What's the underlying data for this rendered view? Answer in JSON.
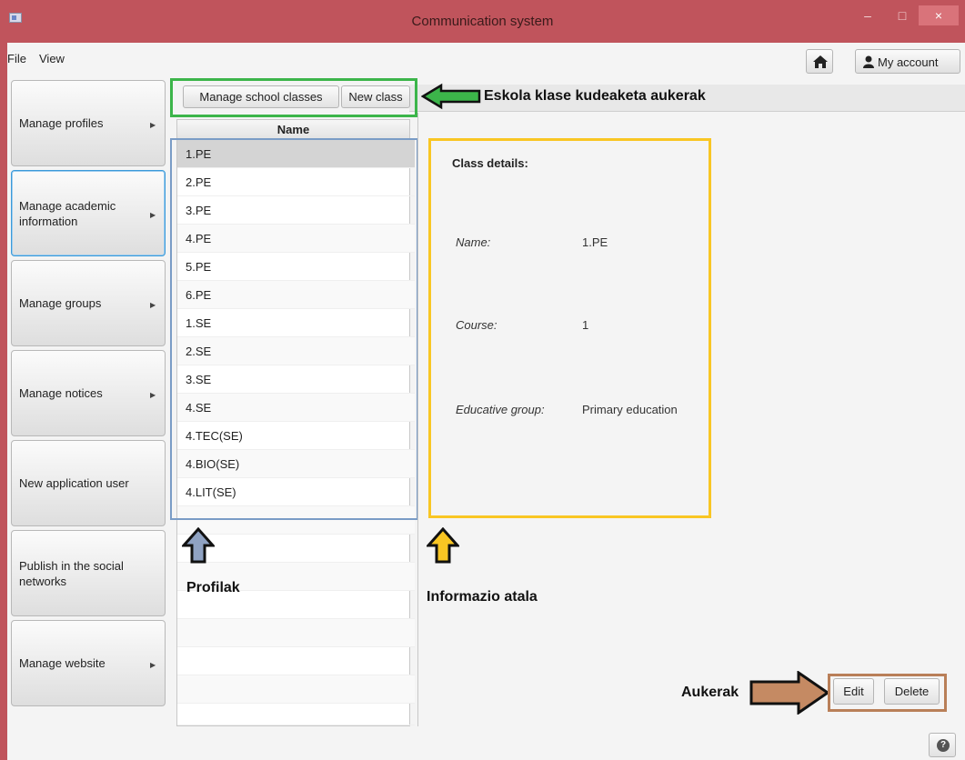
{
  "window": {
    "title": "Communication system",
    "minimize": "–",
    "maximize": "□",
    "close": "×"
  },
  "menu": {
    "file": "File",
    "view": "View"
  },
  "header": {
    "account_label": "My account",
    "home_icon": "home-icon",
    "account_icon": "user-icon"
  },
  "sidebar": {
    "items": [
      {
        "label": "Manage profiles",
        "submenu": true
      },
      {
        "label": "Manage academic information",
        "submenu": true,
        "active": true
      },
      {
        "label": "Manage groups",
        "submenu": true
      },
      {
        "label": "Manage notices",
        "submenu": true
      },
      {
        "label": "New application user",
        "submenu": false
      },
      {
        "label": "Publish in the social networks",
        "submenu": false
      },
      {
        "label": "Manage website",
        "submenu": true
      }
    ],
    "arrow_glyph": "▶"
  },
  "toolbar": {
    "manage_label": "Manage school classes",
    "new_label": "New class"
  },
  "list": {
    "header": "Name",
    "rows": [
      "1.PE",
      "2.PE",
      "3.PE",
      "4.PE",
      "5.PE",
      "6.PE",
      "1.SE",
      "2.SE",
      "3.SE",
      "4.SE",
      "4.TEC(SE)",
      "4.BIO(SE)",
      "4.LIT(SE)"
    ],
    "selected_index": 0
  },
  "details": {
    "title": "Class details:",
    "name_label": "Name:",
    "name_value": "1.PE",
    "course_label": "Course:",
    "course_value": "1",
    "group_label": "Educative group:",
    "group_value": "Primary education"
  },
  "annotations": {
    "toolbar_note": "Eskola klase kudeaketa aukerak",
    "list_note": "Profilak",
    "details_note": "Informazio atala",
    "actions_note": "Aukerak",
    "colors": {
      "green": "#3cb54a",
      "blue": "#7a9cc6",
      "yellow": "#f9c623",
      "brown": "#b97f58"
    }
  },
  "actions": {
    "edit": "Edit",
    "delete": "Delete"
  },
  "statusbar": {
    "help_icon": "help-icon",
    "help_glyph": "?"
  },
  "colors": {
    "titlebar": "#c0545c",
    "close_button": "#d9737a",
    "selected_row": "#d4d4d4",
    "active_border": "#3a9ad9"
  }
}
